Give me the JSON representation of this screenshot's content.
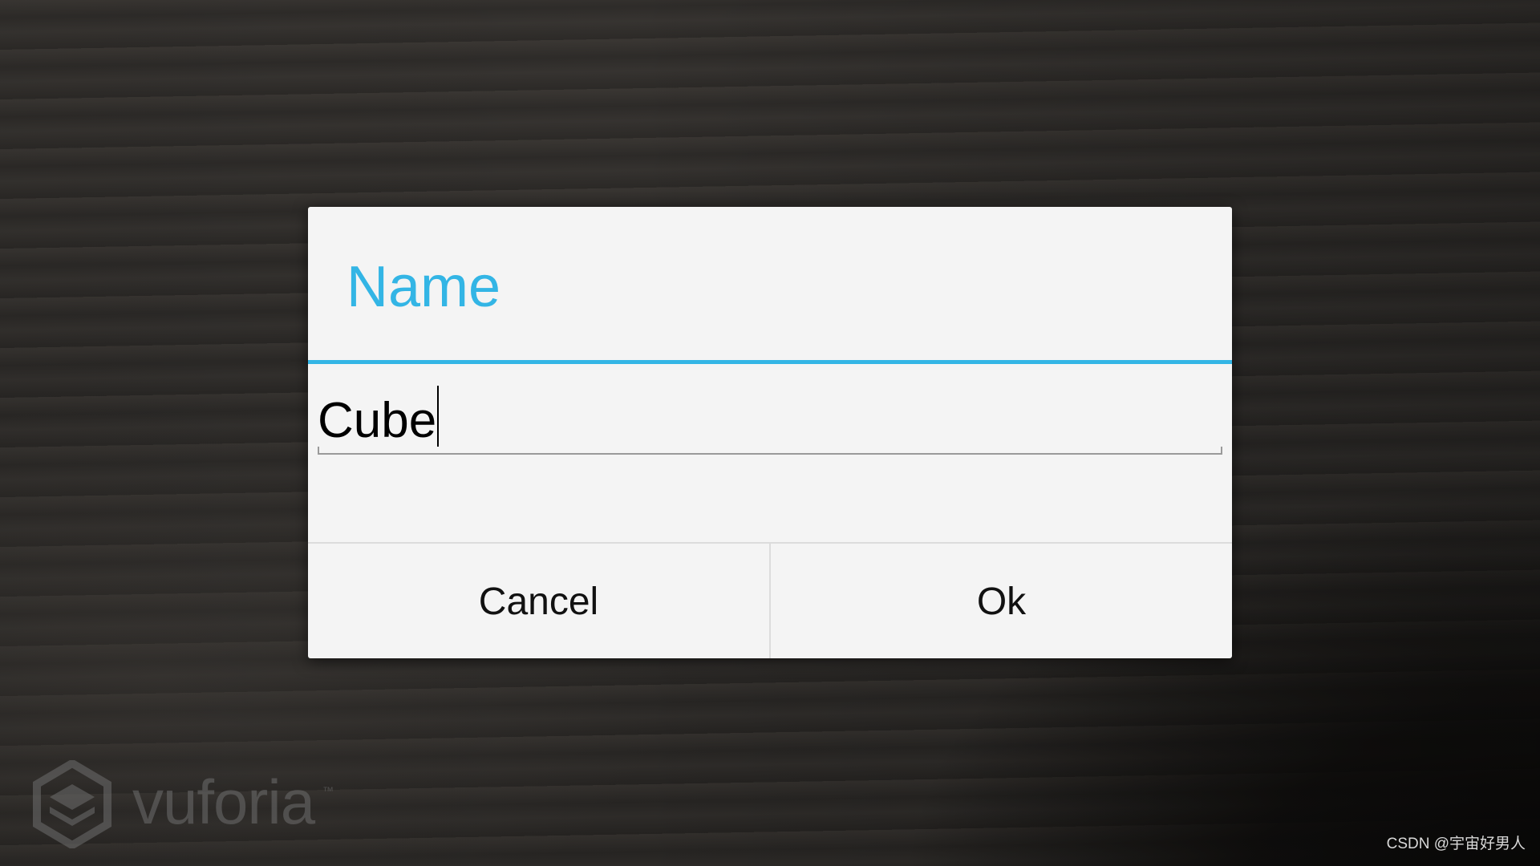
{
  "dialog": {
    "title": "Name",
    "input_value": "Cube",
    "cancel_label": "Cancel",
    "ok_label": "Ok"
  },
  "logo": {
    "text": "vuforia",
    "trademark": "™"
  },
  "watermark": "CSDN @宇宙好男人",
  "colors": {
    "accent": "#33b5e5",
    "dialog_bg": "#f4f4f4",
    "text": "#111111"
  },
  "icons": [
    "vuforia-logo-icon",
    "text-caret"
  ]
}
